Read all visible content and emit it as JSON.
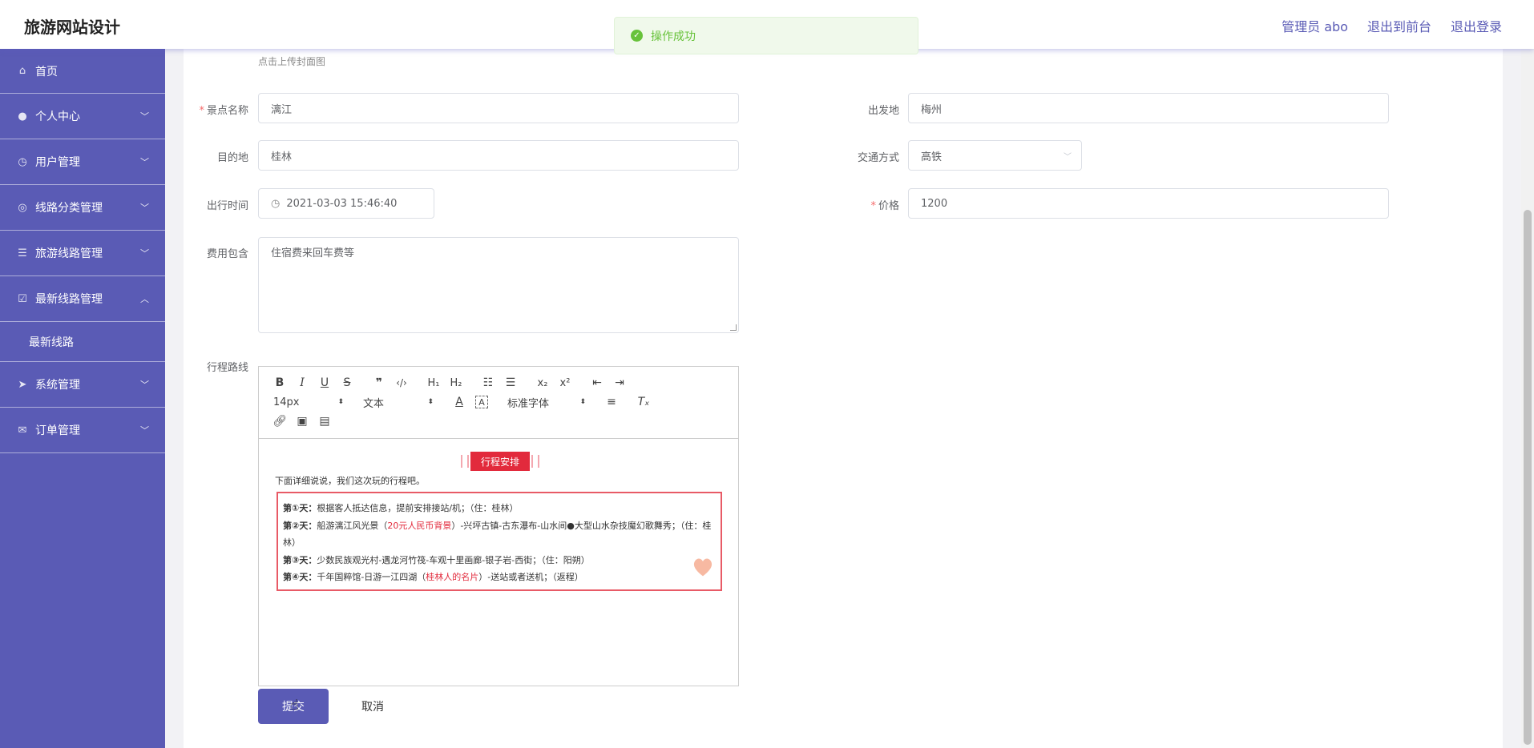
{
  "app": {
    "title": "旅游网站设计",
    "top_links": [
      "管理员 abo",
      "退出到前台",
      "退出登录"
    ]
  },
  "toast": {
    "message": "操作成功"
  },
  "sidebar": {
    "items": [
      {
        "label": "首页",
        "icon": "home-icon",
        "expandable": false
      },
      {
        "label": "个人中心",
        "icon": "user-icon",
        "expandable": true
      },
      {
        "label": "用户管理",
        "icon": "clock-icon",
        "expandable": true
      },
      {
        "label": "线路分类管理",
        "icon": "compass-icon",
        "expandable": true
      },
      {
        "label": "旅游线路管理",
        "icon": "sliders-icon",
        "expandable": true
      },
      {
        "label": "最新线路管理",
        "icon": "checkbox-icon",
        "expandable": true,
        "expanded": true,
        "children": [
          "最新线路"
        ]
      },
      {
        "label": "系统管理",
        "icon": "send-icon",
        "expandable": true
      },
      {
        "label": "订单管理",
        "icon": "mail-icon",
        "expandable": true
      }
    ]
  },
  "form": {
    "cover_hint": "点击上传封面图",
    "spot_name": {
      "label": "景点名称",
      "value": "漓江",
      "required": true
    },
    "departure": {
      "label": "出发地",
      "value": "梅州"
    },
    "destination": {
      "label": "目的地",
      "value": "桂林"
    },
    "transport": {
      "label": "交通方式",
      "value": "高铁"
    },
    "travel_time": {
      "label": "出行时间",
      "value": "2021-03-03 15:46:40"
    },
    "price": {
      "label": "价格",
      "value": "1200",
      "required": true
    },
    "fee_includes": {
      "label": "费用包含",
      "value": "住宿费来回车费等"
    },
    "itinerary": {
      "label": "行程路线"
    }
  },
  "editor": {
    "font_size": "14px",
    "text_type": "文本",
    "font_family": "标准字体",
    "banner": "行程安排",
    "intro": "下面详细说说，我们这次玩的行程吧。",
    "days": [
      {
        "day": "第①天：",
        "text": "根据客人抵达信息，提前安排接站/机；（住：桂林）"
      },
      {
        "day": "第②天：",
        "pre": "船游漓江风光景（",
        "red": "20元人民币背景",
        "post": "）-兴坪古镇-古东瀑布-山水间●大型山水杂技魔幻歌舞秀；（住：桂林）"
      },
      {
        "day": "第③天：",
        "text": "少数民族观光村-遇龙河竹筏-车观十里画廊-银子岩-西街；（住：阳朔）"
      },
      {
        "day": "第④天：",
        "pre": "千年国粹馆-日游一江四湖（",
        "red": "桂林人的名片",
        "post": "）-送站或者送机；（返程）"
      }
    ]
  },
  "buttons": {
    "submit": "提交",
    "cancel": "取消"
  },
  "colors": {
    "primary": "#5a5bb5",
    "success": "#67c23a",
    "required": "#f56c6c",
    "accent_red": "#e22a3c"
  }
}
